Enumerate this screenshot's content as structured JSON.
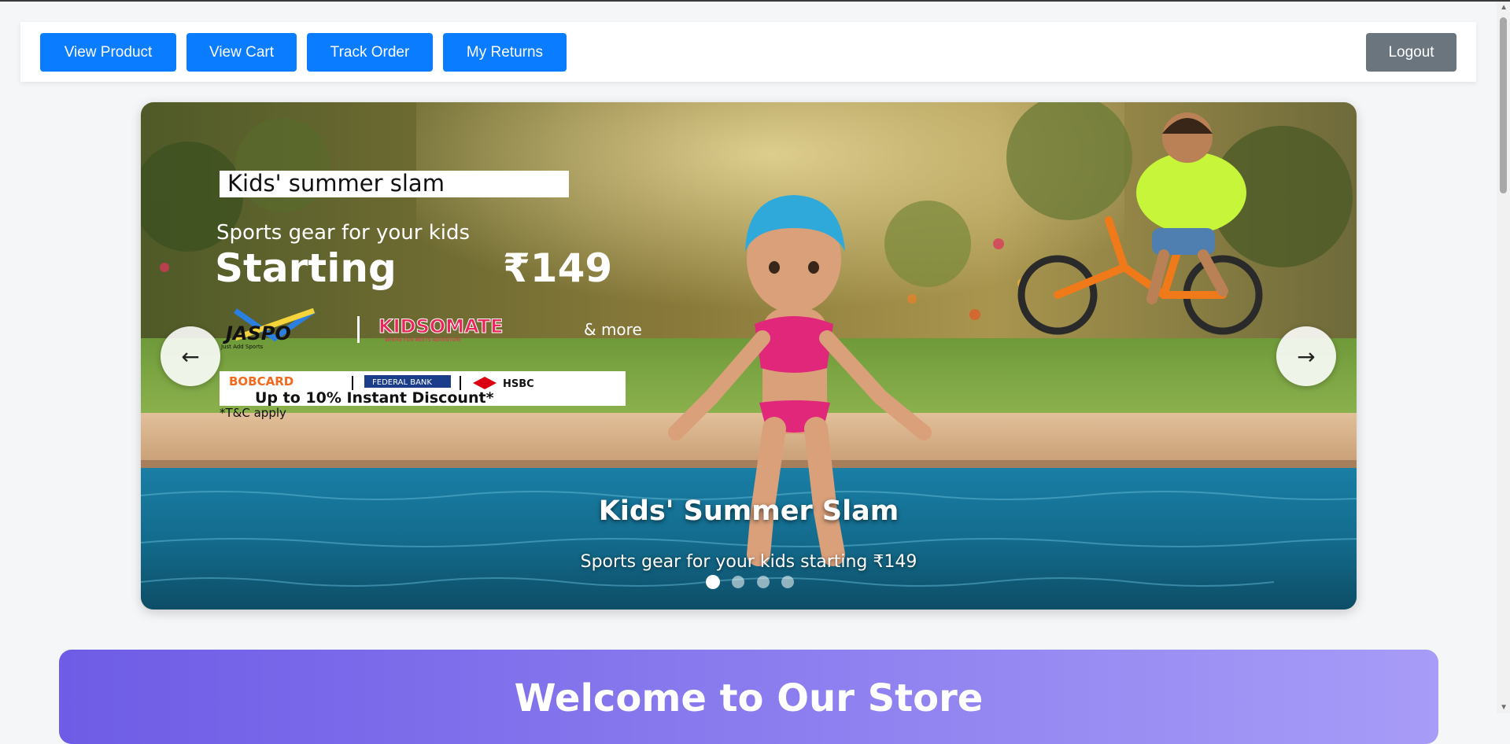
{
  "nav": {
    "view_product": "View Product",
    "view_cart": "View Cart",
    "track_order": "Track Order",
    "my_returns": "My Returns",
    "logout": "Logout"
  },
  "banner": {
    "tag": "Kids' summer slam",
    "line1": "Sports gear for your kids",
    "line2_prefix": "Starting",
    "line2_price": "₹149",
    "brand1": "JASPO",
    "brand1_tagline": "Just Add Sports",
    "brand2": "KIDSOMATE",
    "brand2_tagline": "WHERE FUN MEETS ADVENTURE",
    "and_more": "& more",
    "bank1": "BOBCARD",
    "bank2": "FEDERAL BANK",
    "bank3": "HSBC",
    "discount": "Up to 10% Instant Discount*",
    "terms": "*T&C apply"
  },
  "carousel": {
    "prev_icon": "←",
    "next_icon": "→",
    "slide_title": "Kids' Summer Slam",
    "slide_subtitle": "Sports gear for your kids starting ₹149",
    "slide_count": 4,
    "active_index": 0
  },
  "welcome": {
    "title": "Welcome to Our Store"
  },
  "colors": {
    "primary": "#0a7cff",
    "secondary": "#6b757d",
    "welcome_gradient_start": "#6e5ce6",
    "welcome_gradient_end": "#a79cf7"
  }
}
